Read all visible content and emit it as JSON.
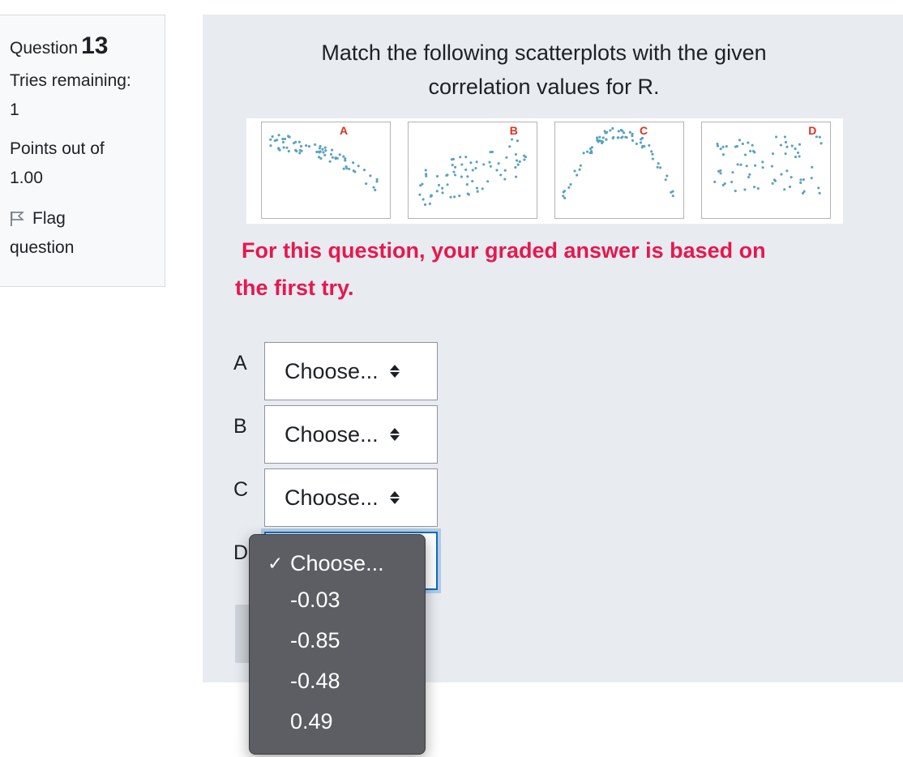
{
  "info": {
    "question_label": "Question",
    "question_number": "13",
    "tries_label": "Tries remaining:",
    "tries_value": "1",
    "points_label": "Points out of",
    "points_value": "1.00",
    "flag_label_1": "Flag",
    "flag_label_2": "question"
  },
  "question": {
    "prompt_line1": "Match the following scatterplots with the given",
    "prompt_line2": "correlation values for R.",
    "note_line1": "For this question, your graded answer is based on",
    "note_line2": "the first try."
  },
  "scatterplots": {
    "labels": [
      "A",
      "B",
      "C",
      "D"
    ],
    "point_color": "#5aa3bf",
    "label_color": "#e0301e"
  },
  "answers": {
    "rows": [
      {
        "label": "A",
        "value": "Choose..."
      },
      {
        "label": "B",
        "value": "Choose..."
      },
      {
        "label": "C",
        "value": "Choose..."
      },
      {
        "label": "D",
        "value": ""
      }
    ]
  },
  "dropdown": {
    "selected_index": 0,
    "check": "✓",
    "options": [
      "Choose...",
      "-0.03",
      "-0.85",
      "-0.48",
      "0.49"
    ]
  },
  "colors": {
    "content_bg": "#e8ecf1",
    "note": "#e8174e",
    "focus": "#0f6cbf",
    "menu_bg": "#5c5e63"
  }
}
